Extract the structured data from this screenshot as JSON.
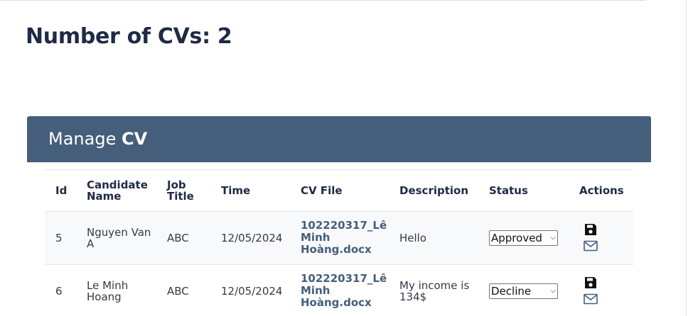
{
  "page": {
    "count_title": "Number of CVs: 2"
  },
  "panel": {
    "title_prefix": "Manage",
    "title_strong": "CV"
  },
  "table": {
    "headers": {
      "id": "Id",
      "candidate_name": "Candidate Name",
      "job_title": "Job Title",
      "time": "Time",
      "cv_file": "CV File",
      "description": "Description",
      "status": "Status",
      "actions": "Actions"
    },
    "rows": [
      {
        "id": "5",
        "candidate_name": "Nguyen Van A",
        "job_title": "ABC",
        "time": "12/05/2024",
        "cv_file": "102220317_Lê Minh Hoàng.docx",
        "description": "Hello",
        "status": "Approved"
      },
      {
        "id": "6",
        "candidate_name": "Le Minh Hoang",
        "job_title": "ABC",
        "time": "12/05/2024",
        "cv_file": "102220317_Lê Minh Hoàng.docx",
        "description": "My income is 134$",
        "status": "Decline"
      }
    ],
    "action_icons": [
      "save-icon",
      "mail-icon"
    ]
  },
  "colors": {
    "header_bg": "#455e7c",
    "title_text": "#1f2a44",
    "link": "#455e7c"
  }
}
